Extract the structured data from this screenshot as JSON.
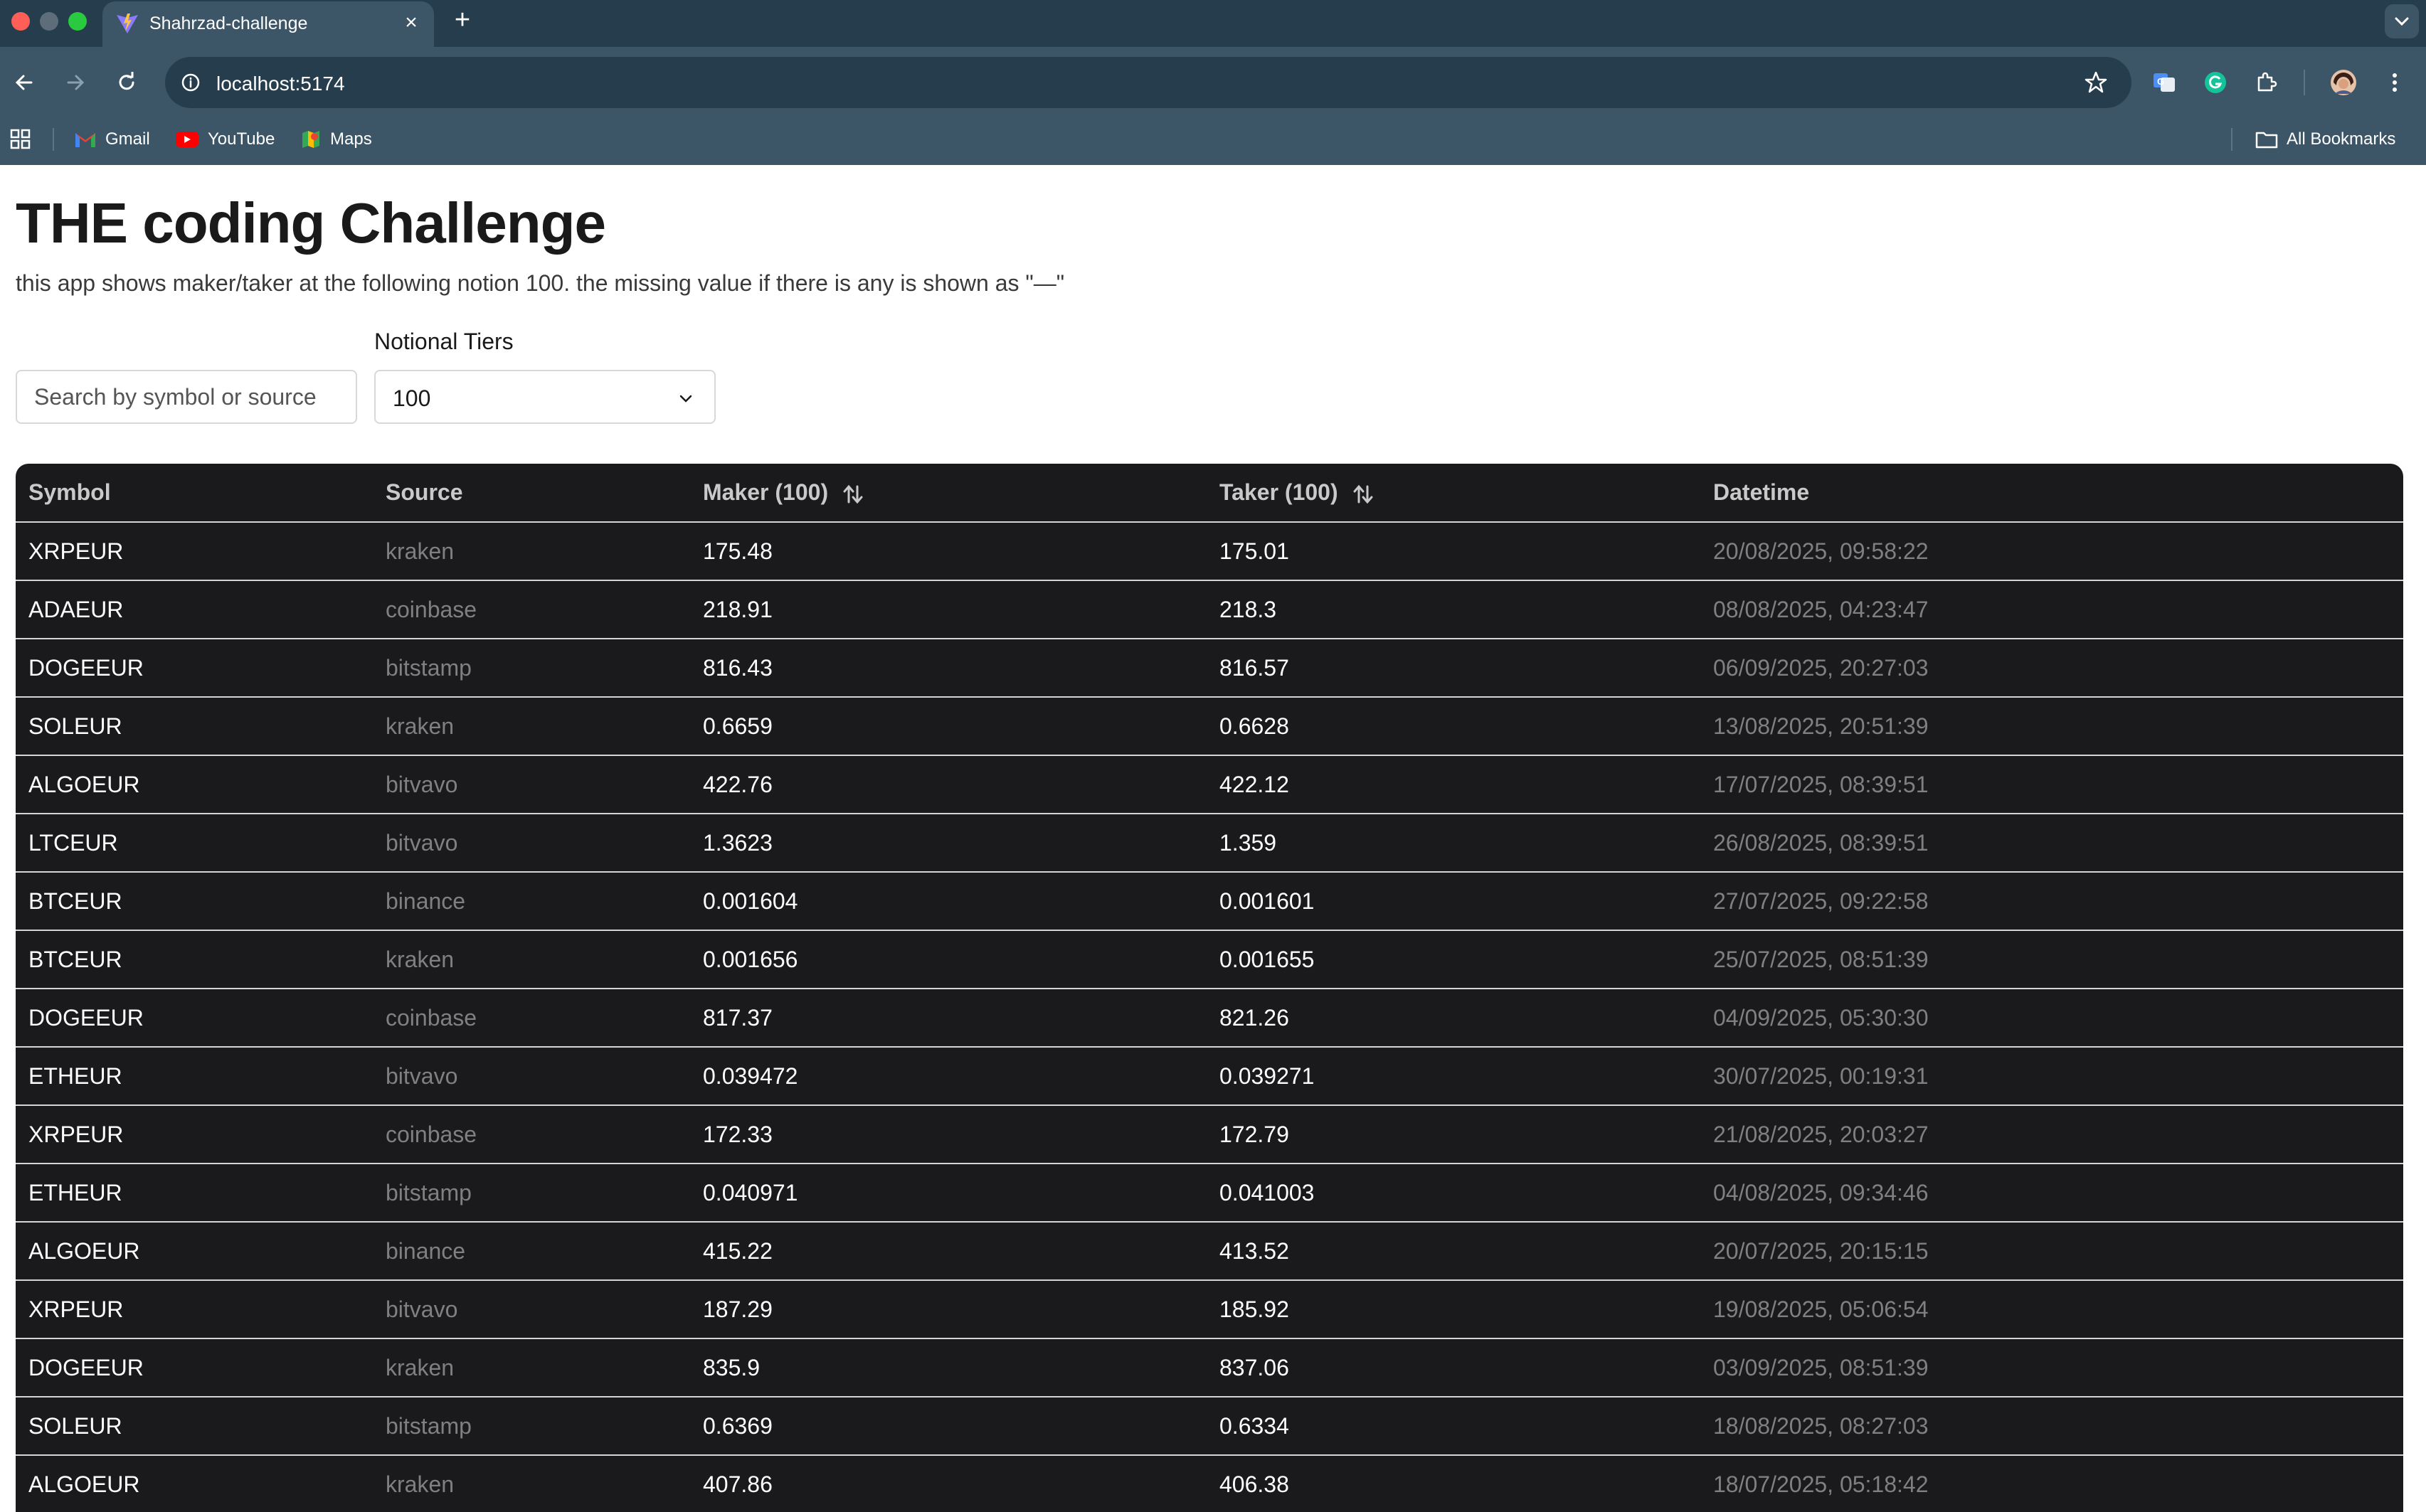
{
  "browser": {
    "tab_title": "Shahrzad-challenge",
    "url": "localhost:5174",
    "bookmarks": [
      {
        "label": "Gmail",
        "icon": "gmail-icon"
      },
      {
        "label": "YouTube",
        "icon": "youtube-icon"
      },
      {
        "label": "Maps",
        "icon": "maps-icon"
      }
    ],
    "all_bookmarks": "All Bookmarks"
  },
  "page": {
    "title": "THE coding Challenge",
    "subtitle": "this app shows maker/taker at the following notion 100. the missing value if there is any is shown as \"—\"",
    "search_placeholder": "Search by symbol or source",
    "tier_label": "Notional Tiers",
    "tier_value": "100"
  },
  "table": {
    "headers": {
      "symbol": "Symbol",
      "source": "Source",
      "maker": "Maker (100)",
      "taker": "Taker (100)",
      "datetime": "Datetime"
    },
    "rows": [
      {
        "symbol": "XRPEUR",
        "source": "kraken",
        "maker": "175.48",
        "taker": "175.01",
        "datetime": "20/08/2025, 09:58:22"
      },
      {
        "symbol": "ADAEUR",
        "source": "coinbase",
        "maker": "218.91",
        "taker": "218.3",
        "datetime": "08/08/2025, 04:23:47"
      },
      {
        "symbol": "DOGEEUR",
        "source": "bitstamp",
        "maker": "816.43",
        "taker": "816.57",
        "datetime": "06/09/2025, 20:27:03"
      },
      {
        "symbol": "SOLEUR",
        "source": "kraken",
        "maker": "0.6659",
        "taker": "0.6628",
        "datetime": "13/08/2025, 20:51:39"
      },
      {
        "symbol": "ALGOEUR",
        "source": "bitvavo",
        "maker": "422.76",
        "taker": "422.12",
        "datetime": "17/07/2025, 08:39:51"
      },
      {
        "symbol": "LTCEUR",
        "source": "bitvavo",
        "maker": "1.3623",
        "taker": "1.359",
        "datetime": "26/08/2025, 08:39:51"
      },
      {
        "symbol": "BTCEUR",
        "source": "binance",
        "maker": "0.001604",
        "taker": "0.001601",
        "datetime": "27/07/2025, 09:22:58"
      },
      {
        "symbol": "BTCEUR",
        "source": "kraken",
        "maker": "0.001656",
        "taker": "0.001655",
        "datetime": "25/07/2025, 08:51:39"
      },
      {
        "symbol": "DOGEEUR",
        "source": "coinbase",
        "maker": "817.37",
        "taker": "821.26",
        "datetime": "04/09/2025, 05:30:30"
      },
      {
        "symbol": "ETHEUR",
        "source": "bitvavo",
        "maker": "0.039472",
        "taker": "0.039271",
        "datetime": "30/07/2025, 00:19:31"
      },
      {
        "symbol": "XRPEUR",
        "source": "coinbase",
        "maker": "172.33",
        "taker": "172.79",
        "datetime": "21/08/2025, 20:03:27"
      },
      {
        "symbol": "ETHEUR",
        "source": "bitstamp",
        "maker": "0.040971",
        "taker": "0.041003",
        "datetime": "04/08/2025, 09:34:46"
      },
      {
        "symbol": "ALGOEUR",
        "source": "binance",
        "maker": "415.22",
        "taker": "413.52",
        "datetime": "20/07/2025, 20:15:15"
      },
      {
        "symbol": "XRPEUR",
        "source": "bitvavo",
        "maker": "187.29",
        "taker": "185.92",
        "datetime": "19/08/2025, 05:06:54"
      },
      {
        "symbol": "DOGEEUR",
        "source": "kraken",
        "maker": "835.9",
        "taker": "837.06",
        "datetime": "03/09/2025, 08:51:39"
      },
      {
        "symbol": "SOLEUR",
        "source": "bitstamp",
        "maker": "0.6369",
        "taker": "0.6334",
        "datetime": "18/08/2025, 08:27:03"
      },
      {
        "symbol": "ALGOEUR",
        "source": "kraken",
        "maker": "407.86",
        "taker": "406.38",
        "datetime": "18/07/2025, 05:18:42"
      }
    ]
  },
  "colors": {
    "chrome_bg": "#3c5668",
    "tabstrip_bg": "#263d4e",
    "table_bg": "#1a1a1d",
    "dim_text": "#808080"
  }
}
